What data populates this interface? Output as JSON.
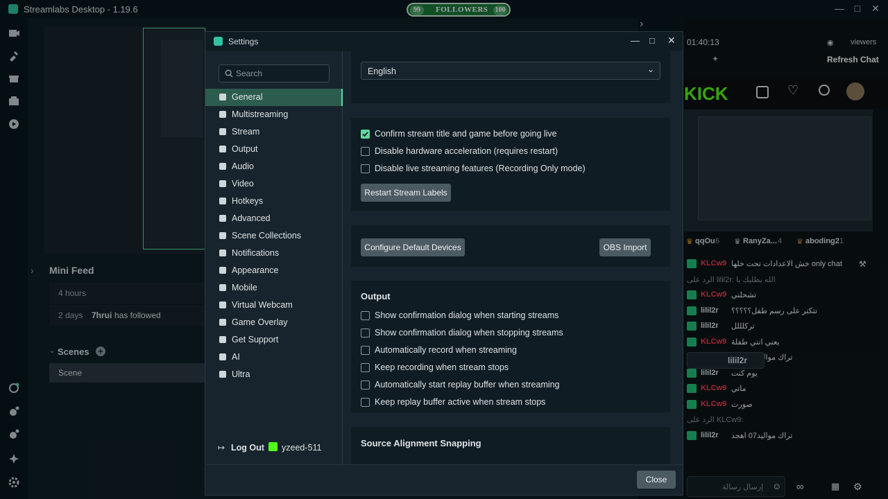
{
  "app": {
    "title": "Streamlabs Desktop - 1.19.6"
  },
  "followers_bar": {
    "current": "99",
    "label": "FOLLOWERS",
    "goal": "100",
    "progress": 0.99
  },
  "editor": {
    "mini_feed": {
      "title": "Mini Feed",
      "items": [
        {
          "time": "4 hours",
          "user": "",
          "action": ""
        },
        {
          "time": "2 days",
          "user": "7hrui",
          "action": "has followed"
        }
      ]
    },
    "scenes": {
      "title": "Scenes",
      "items": [
        "Scene"
      ]
    }
  },
  "chat": {
    "timer": "01:40:13",
    "viewers_label": "viewers",
    "refresh": "Refresh Chat",
    "logo_text": "KICK",
    "top_users": [
      {
        "name": "qqOu",
        "count": "6"
      },
      {
        "name": "RanyZa...",
        "count": "4"
      },
      {
        "name": "aboding2",
        "count": "1"
      }
    ],
    "messages": [
      {
        "user": "KLCw9",
        "text": "خش الاعدادات تحت خلها only chat",
        "color": "#ff3b57"
      },
      {
        "user": "",
        "text": "الرد على lilil2r: الله يطلبك يا",
        "color": "#8a949a"
      },
      {
        "user": "KLCw9",
        "text": "تشحلني",
        "color": "#ff3b57"
      },
      {
        "user": "lilil2r",
        "text": "تتكنر على رسم طفل؟؟؟؟؟",
        "color": "#dfe6ea"
      },
      {
        "user": "lilil2r",
        "text": "تركلللل",
        "color": "#dfe6ea"
      },
      {
        "user": "KLCw9",
        "text": "يعني انتي طفلة",
        "color": "#ff3b57"
      },
      {
        "user": "lilil2r",
        "text": "تراك مواليد07 اهجد",
        "color": "#dfe6ea"
      },
      {
        "user": "lilil2r",
        "text": "يوم كنت",
        "color": "#dfe6ea"
      },
      {
        "user": "KLCw9",
        "text": "ماتي",
        "color": "#ff3b57"
      },
      {
        "user": "KLCw9",
        "text": "صورت",
        "color": "#ff3b57"
      },
      {
        "user": "",
        "text": "الرد على KLCw9:",
        "color": "#8a949a"
      },
      {
        "user": "lilil2r",
        "text": "تراك مواليد07 اهجد",
        "color": "#dfe6ea"
      }
    ],
    "tooltip_text": "lilil2r",
    "input_placeholder": "إرسال رسالة"
  },
  "settings": {
    "title": "Settings",
    "search_placeholder": "Search",
    "nav": [
      {
        "label": "General",
        "icon": "grid-icon",
        "active": true
      },
      {
        "label": "Multistreaming",
        "icon": "multistream-icon"
      },
      {
        "label": "Stream",
        "icon": "globe-icon"
      },
      {
        "label": "Output",
        "icon": "output-icon"
      },
      {
        "label": "Audio",
        "icon": "audio-icon"
      },
      {
        "label": "Video",
        "icon": "video-icon"
      },
      {
        "label": "Hotkeys",
        "icon": "hotkeys-icon"
      },
      {
        "label": "Advanced",
        "icon": "wrench-icon"
      },
      {
        "label": "Scene Collections",
        "icon": "scene-collections-icon"
      },
      {
        "label": "Notifications",
        "icon": "bell-icon"
      },
      {
        "label": "Appearance",
        "icon": "appearance-icon"
      },
      {
        "label": "Mobile",
        "icon": "mobile-icon"
      },
      {
        "label": "Virtual Webcam",
        "icon": "camera-icon"
      },
      {
        "label": "Game Overlay",
        "icon": "overlay-icon"
      },
      {
        "label": "Get Support",
        "icon": "help-icon"
      },
      {
        "label": "AI",
        "icon": "sparkle-icon"
      },
      {
        "label": "Ultra",
        "icon": "ultra-icon"
      }
    ],
    "logout": "Log Out",
    "username": "yzeed-511",
    "language": {
      "value": "English"
    },
    "general_options": [
      {
        "label": "Confirm stream title and game before going live",
        "checked": true
      },
      {
        "label": "Disable hardware acceleration (requires restart)",
        "checked": false
      },
      {
        "label": "Disable live streaming features (Recording Only mode)",
        "checked": false
      }
    ],
    "restart_labels_button": "Restart Stream Labels",
    "configure_devices_button": "Configure Default Devices",
    "obs_import_button": "OBS Import",
    "output": {
      "title": "Output",
      "options": [
        {
          "label": "Show confirmation dialog when starting streams",
          "checked": false
        },
        {
          "label": "Show confirmation dialog when stopping streams",
          "checked": false
        },
        {
          "label": "Automatically record when streaming",
          "checked": false
        },
        {
          "label": "Keep recording when stream stops",
          "checked": false
        },
        {
          "label": "Automatically start replay buffer when streaming",
          "checked": false
        },
        {
          "label": "Keep replay buffer active when stream stops",
          "checked": false
        }
      ]
    },
    "source_alignment": "Source Alignment Snapping",
    "close_button": "Close"
  }
}
